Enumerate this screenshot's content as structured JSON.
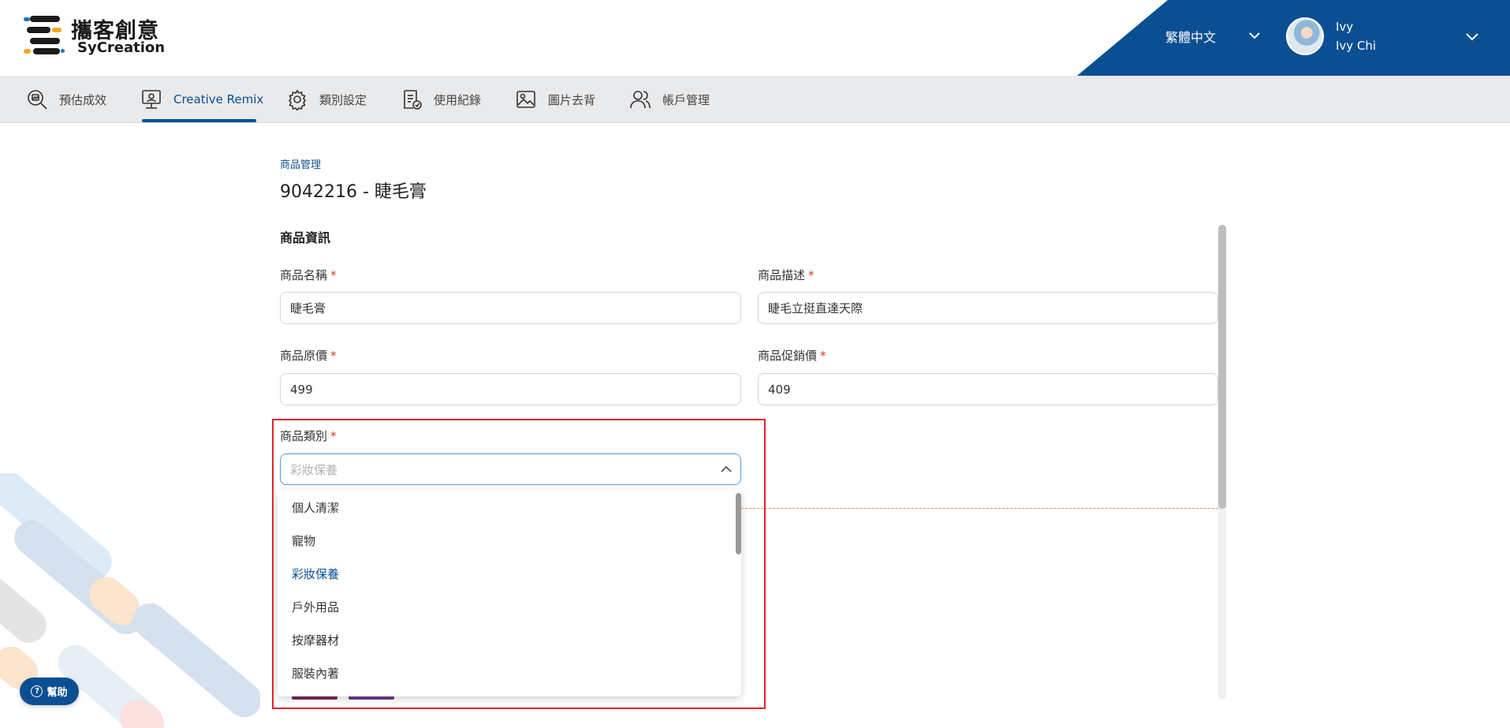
{
  "brand": {
    "name_cn": "攜客創意",
    "name_en": "SyCreation"
  },
  "header": {
    "language": "繁體中文",
    "user": {
      "short_name": "Ivy",
      "full_name": "Ivy Chi"
    }
  },
  "nav": {
    "items": [
      {
        "label": "預估成效",
        "icon": "performance-search-icon",
        "active": false
      },
      {
        "label": "Creative Remix",
        "icon": "monitor-remix-icon",
        "active": true
      },
      {
        "label": "類別設定",
        "icon": "gear-icon",
        "active": false
      },
      {
        "label": "使用紀錄",
        "icon": "record-icon",
        "active": false
      },
      {
        "label": "圖片去背",
        "icon": "image-icon",
        "active": false
      },
      {
        "label": "帳戶管理",
        "icon": "users-icon",
        "active": false
      }
    ]
  },
  "page": {
    "breadcrumb": "商品管理",
    "title": "9042216 - 睫毛膏",
    "section": "商品資訊"
  },
  "form": {
    "name": {
      "label": "商品名稱",
      "value": "睫毛膏"
    },
    "description": {
      "label": "商品描述",
      "value": "睫毛立挺直達天際"
    },
    "original_price": {
      "label": "商品原價",
      "value": "499"
    },
    "sale_price": {
      "label": "商品促銷價",
      "value": "409"
    },
    "category": {
      "label": "商品類別",
      "placeholder": "彩妝保養",
      "options": [
        "個人清潔",
        "寵物",
        "彩妝保養",
        "戶外用品",
        "按摩器材",
        "服裝內著"
      ],
      "selected": "彩妝保養"
    },
    "required_mark": "*"
  },
  "help": {
    "label": "幫助",
    "icon": "question-circle-icon"
  },
  "colors": {
    "brand_blue": "#0b4f93",
    "required_red": "#d9342b",
    "highlight_red": "#e0262b",
    "accent_orange": "#f29a3a"
  }
}
